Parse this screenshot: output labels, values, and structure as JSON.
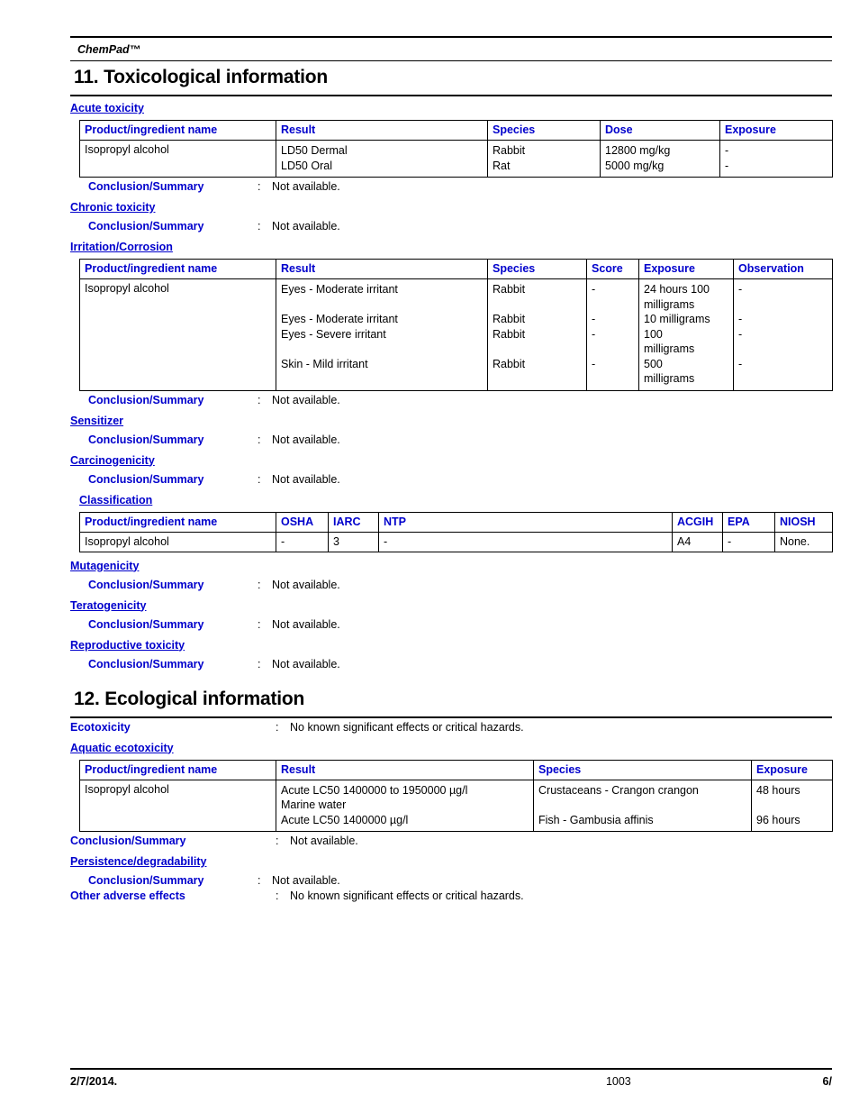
{
  "header": {
    "title": "ChemPad™"
  },
  "sections": [
    {
      "id": "tox",
      "title": "11. Toxicological information"
    },
    {
      "id": "eco",
      "title": "12. Ecological information"
    }
  ],
  "tox": {
    "acute_toxicity_head": "Acute toxicity",
    "acute_table": {
      "columns": [
        "Product/ingredient name",
        "Result",
        "Species",
        "Dose",
        "Exposure"
      ],
      "rows": [
        {
          "name": "Isopropyl alcohol",
          "result": "LD50 Dermal\nLD50 Oral",
          "species": "Rabbit\nRat",
          "dose": "12800 mg/kg\n5000 mg/kg",
          "exposure": "-\n-"
        }
      ]
    },
    "acute_conclusion": {
      "label": "Conclusion/Summary",
      "colon": ":",
      "value": "Not available."
    },
    "chronic_toxicity_head": "Chronic toxicity",
    "chronic_conclusion": {
      "label": "Conclusion/Summary",
      "colon": ":",
      "value": "Not available."
    },
    "irritation_head": "Irritation/Corrosion",
    "irritation_table": {
      "columns": [
        "Product/ingredient name",
        "Result",
        "Species",
        "Score",
        "Exposure",
        "Observation"
      ],
      "rows": [
        {
          "name": "Isopropyl alcohol",
          "result": "Eyes - Moderate irritant\n\nEyes - Moderate irritant\nEyes - Severe irritant\n\nSkin - Mild irritant",
          "species": "Rabbit\n\nRabbit\nRabbit\n\nRabbit",
          "score": "-\n\n-\n-\n\n-",
          "exposure": "24 hours 100\nmilligrams\n10 milligrams\n100\nmilligrams\n500\nmilligrams",
          "observation": "-\n\n-\n-\n\n-"
        }
      ]
    },
    "irritation_conclusion": {
      "label": "Conclusion/Summary",
      "colon": ":",
      "value": "Not available."
    },
    "sensitizer_head": "Sensitizer",
    "sensitizer_conclusion": {
      "label": "Conclusion/Summary",
      "colon": ":",
      "value": "Not available."
    },
    "carcinogenicity_head": "Carcinogenicity",
    "carcinogenicity_conclusion": {
      "label": "Conclusion/Summary",
      "colon": ":",
      "value": "Not available."
    },
    "classification_head": "Classification",
    "classification_table": {
      "columns": [
        "Product/ingredient name",
        "OSHA",
        "IARC",
        "NTP",
        "ACGIH",
        "EPA",
        "NIOSH"
      ],
      "rows": [
        {
          "name": "Isopropyl alcohol",
          "osha": "-",
          "iarc": "3",
          "ntp": "-",
          "acgih": "A4",
          "epa": "-",
          "niosh": "None."
        }
      ]
    },
    "mutagenicity_head": "Mutagenicity",
    "mutagenicity_conclusion": {
      "label": "Conclusion/Summary",
      "colon": ":",
      "value": "Not available."
    },
    "teratogenicity_head": "Teratogenicity",
    "teratogenicity_conclusion": {
      "label": "Conclusion/Summary",
      "colon": ":",
      "value": "Not available."
    },
    "reproductive_head": "Reproductive toxicity",
    "reproductive_conclusion": {
      "label": "Conclusion/Summary",
      "colon": ":",
      "value": "Not available."
    }
  },
  "eco": {
    "ecotoxicity": {
      "label": "Ecotoxicity",
      "colon": ":",
      "value": "No known significant effects or critical hazards."
    },
    "aquatic_head": "Aquatic ecotoxicity",
    "aquatic_table": {
      "columns": [
        "Product/ingredient name",
        "Result",
        "Species",
        "Exposure"
      ],
      "rows": [
        {
          "name": "Isopropyl alcohol",
          "result": "Acute LC50 1400000 to 1950000 µg/l\nMarine water\nAcute LC50 1400000 µg/l",
          "species": "Crustaceans - Crangon crangon\n\nFish - Gambusia affinis",
          "exposure": "48 hours\n\n96 hours"
        }
      ]
    },
    "aquatic_conclusion": {
      "label": "Conclusion/Summary",
      "colon": ":",
      "value": "Not available."
    },
    "persistence_head": "Persistence/degradability",
    "persistence_conclusion": {
      "label": "Conclusion/Summary",
      "colon": ":",
      "value": "Not available."
    },
    "other_adverse": {
      "label": "Other adverse effects",
      "colon": ":",
      "value": "No known significant effects or critical hazards."
    }
  },
  "footer": {
    "date": "2/7/2014.",
    "doc_number": "1003",
    "page": "6/"
  }
}
